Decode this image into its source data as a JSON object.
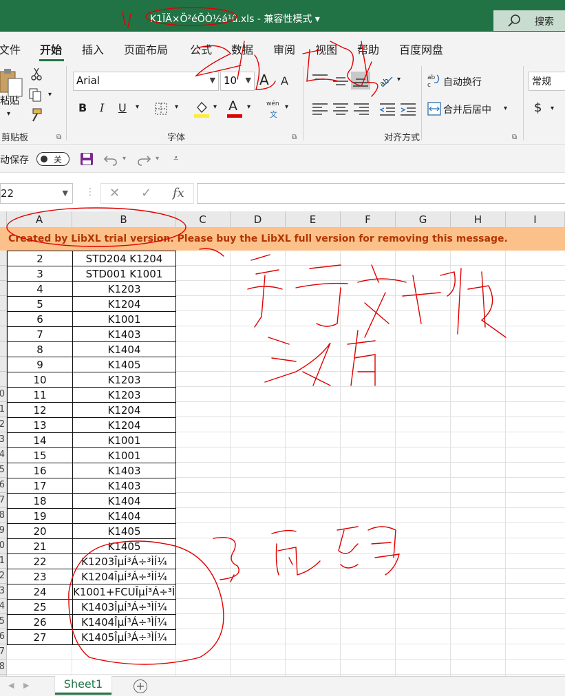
{
  "window": {
    "title": "K1ÏÄ×Ö²éÕÒ½á¹û.xls  -  兼容性模式  ▾",
    "search_label": "搜索"
  },
  "menu": {
    "tabs": [
      "文件",
      "开始",
      "插入",
      "页面布局",
      "公式",
      "数据",
      "审阅",
      "视图",
      "帮助",
      "百度网盘"
    ],
    "active": "开始"
  },
  "ribbon": {
    "clipboard": {
      "paste_label": "粘贴",
      "group_label": "剪贴板"
    },
    "font": {
      "font_name": "Arial",
      "font_size": "10",
      "bold": "B",
      "italic": "I",
      "underline": "U",
      "font_color_letter": "A",
      "phonetic_top": "wén",
      "phonetic_bottom": "文",
      "grow": "A",
      "shrink": "A",
      "group_label": "字体",
      "fill_color": "#ffeb3b",
      "font_color": "#e00000"
    },
    "alignment": {
      "wrap_text": "自动换行",
      "merge_center": "合并后居中",
      "group_label": "对齐方式"
    },
    "number": {
      "format": "常规",
      "currency": "$"
    }
  },
  "qat": {
    "autosave_label": "动保存",
    "toggle_text": "关"
  },
  "formula_bar": {
    "name_box": "22",
    "cancel": "✕",
    "enter": "✓",
    "fx": "fx",
    "value": ""
  },
  "grid": {
    "columns": [
      "A",
      "B",
      "C",
      "D",
      "E",
      "F",
      "G",
      "H",
      "I"
    ],
    "banner": "Created by LibXL trial version. Please buy the LibXL full version for removing this message.",
    "row_numbers": [
      "",
      "",
      "",
      "",
      "",
      "",
      "",
      "",
      "",
      "0",
      "1",
      "2",
      "3",
      "4",
      "5",
      "6",
      "7",
      "8",
      "9",
      "0",
      "1",
      "2",
      "3",
      "4",
      "5",
      "6",
      "7",
      "8",
      "9"
    ],
    "rows": [
      [
        "2",
        "STD204 K1204"
      ],
      [
        "3",
        "STD001 K1001"
      ],
      [
        "4",
        "K1203"
      ],
      [
        "5",
        "K1204"
      ],
      [
        "6",
        "K1001"
      ],
      [
        "7",
        "K1403"
      ],
      [
        "8",
        "K1404"
      ],
      [
        "9",
        "K1405"
      ],
      [
        "10",
        "K1203"
      ],
      [
        "11",
        "K1203"
      ],
      [
        "12",
        "K1204"
      ],
      [
        "13",
        "K1204"
      ],
      [
        "14",
        "K1001"
      ],
      [
        "15",
        "K1001"
      ],
      [
        "16",
        "K1403"
      ],
      [
        "17",
        "K1403"
      ],
      [
        "18",
        "K1404"
      ],
      [
        "19",
        "K1404"
      ],
      [
        "20",
        "K1405"
      ],
      [
        "21",
        "K1405"
      ],
      [
        "22",
        "K1203ÎµÍ³Á÷³ÌÍ¼"
      ],
      [
        "23",
        "K1204ÎµÍ³Á÷³ÌÍ¼"
      ],
      [
        "24",
        "K1001+FCUÎµÍ³Á÷³ÌÍ¼"
      ],
      [
        "25",
        "K1403ÎµÍ³Á÷³ÌÍ¼"
      ],
      [
        "26",
        "K1404ÎµÍ³Á÷³ÌÍ¼"
      ],
      [
        "27",
        "K1405ÎµÍ³Á÷³ÌÍ¼"
      ]
    ]
  },
  "sheets": {
    "active": "Sheet1",
    "add": "+"
  },
  "colors": {
    "excel_green": "#217346",
    "banner_bg": "#fcc18b",
    "banner_text": "#b33600",
    "annotation": "#e00000"
  }
}
